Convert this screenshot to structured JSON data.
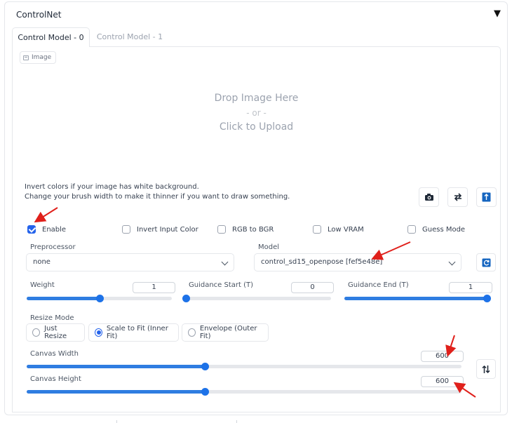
{
  "accordion": {
    "title": "ControlNet",
    "toggle_glyph": "▼"
  },
  "tabs": [
    {
      "label": "Control Model - 0",
      "active": true
    },
    {
      "label": "Control Model - 1",
      "active": false
    }
  ],
  "image_input": {
    "label": "Image",
    "drop_line1": "Drop Image Here",
    "drop_line2": "- or -",
    "drop_line3": "Click to Upload"
  },
  "hints": {
    "line1": "Invert colors if your image has white background.",
    "line2": "Change your brush width to make it thinner if you want to draw something."
  },
  "tool_buttons": [
    {
      "name": "camera-icon"
    },
    {
      "name": "swap-arrows-icon"
    },
    {
      "name": "upload-icon"
    }
  ],
  "checkboxes": [
    {
      "label": "Enable",
      "checked": true
    },
    {
      "label": "Invert Input Color",
      "checked": false
    },
    {
      "label": "RGB to BGR",
      "checked": false
    },
    {
      "label": "Low VRAM",
      "checked": false
    },
    {
      "label": "Guess Mode",
      "checked": false
    }
  ],
  "preprocessor": {
    "label": "Preprocessor",
    "value": "none"
  },
  "model": {
    "label": "Model",
    "value": "control_sd15_openpose [fef5e48e]"
  },
  "sliders": {
    "weight": {
      "label": "Weight",
      "value": "1",
      "fraction": 0.5
    },
    "guidance_start": {
      "label": "Guidance Start (T)",
      "value": "0",
      "fraction": 0.0
    },
    "guidance_end": {
      "label": "Guidance End (T)",
      "value": "1",
      "fraction": 1.0
    },
    "canvas_width": {
      "label": "Canvas Width",
      "value": "600",
      "fraction": 0.41
    },
    "canvas_height": {
      "label": "Canvas Height",
      "value": "600",
      "fraction": 0.41
    }
  },
  "resize_mode": {
    "label": "Resize Mode",
    "options": [
      {
        "label": "Just Resize",
        "selected": false
      },
      {
        "label": "Scale to Fit (Inner Fit)",
        "selected": true
      },
      {
        "label": "Envelope (Outer Fit)",
        "selected": false
      }
    ]
  },
  "colors": {
    "accent": "#2563eb",
    "slider_fill": "#2f7de1",
    "annotation_arrow": "#e0201b"
  }
}
